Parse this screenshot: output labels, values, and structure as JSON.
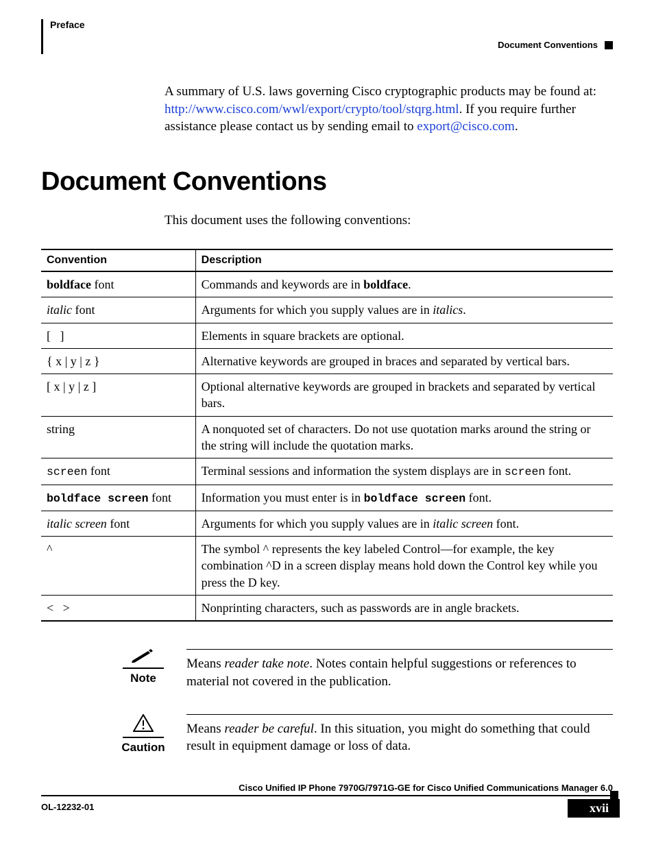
{
  "header": {
    "chapter": "Preface",
    "section": "Document Conventions"
  },
  "intro": {
    "pre": "A summary of U.S. laws governing Cisco cryptographic products may be found at: ",
    "link1": "http://www.cisco.com/wwl/export/crypto/tool/stqrg.html",
    "mid": ". If you require further assistance please contact us by sending email to ",
    "link2": "export@cisco.com",
    "post": "."
  },
  "heading": "Document Conventions",
  "lead": "This document uses the following conventions:",
  "table": {
    "col1_header": "Convention",
    "col2_header": "Description",
    "rows": {
      "r0": {
        "c_html": "<span class='bold'>boldface</span> font",
        "d_html": "Commands and keywords are in <span class='bold'>boldface</span>."
      },
      "r1": {
        "c_html": "<span class='ital'>italic</span> font",
        "d_html": "Arguments for which you supply values are in <span class='ital'>italics</span>."
      },
      "r2": {
        "c_html": "[&nbsp;&nbsp;&nbsp;]",
        "d_html": "Elements in square brackets are optional."
      },
      "r3": {
        "c_html": "{ x | y | z }",
        "d_html": "Alternative keywords are grouped in braces and separated by vertical bars."
      },
      "r4": {
        "c_html": "[ x | y | z ]",
        "d_html": "Optional alternative keywords are grouped in brackets and separated by vertical bars."
      },
      "r5": {
        "c_html": "string",
        "d_html": "A nonquoted set of characters. Do not use quotation marks around the string or the string will include the quotation marks."
      },
      "r6": {
        "c_html": "<span class='mono'>screen</span> font",
        "d_html": "Terminal sessions and information the system displays are in <span class='mono'>screen</span> font."
      },
      "r7": {
        "c_html": "<span class='mono bold'>boldface screen</span> font",
        "d_html": "Information you must enter is in <span class='mono bold'>boldface screen</span> font."
      },
      "r8": {
        "c_html": "<span class='ital'>italic screen</span> font",
        "d_html": "Arguments for which you supply values are in <span class='ital'>italic screen</span> font."
      },
      "r9": {
        "c_html": "^",
        "d_html": "The symbol ^ represents the key labeled Control—for example, the key combination ^D in a screen display means hold down the Control key while you press the D key."
      },
      "r10": {
        "c_html": "&lt;&nbsp;&nbsp;&nbsp;&gt;",
        "d_html": "Nonprinting characters, such as passwords are in angle brackets."
      }
    }
  },
  "note": {
    "label": "Note",
    "body_html": "Means <span class='ital'>reader take note</span>. Notes contain helpful suggestions or references to material not covered in the publication."
  },
  "caution": {
    "label": "Caution",
    "body_html": "Means <span class='ital'>reader be careful</span>. In this situation, you might do something that could result in equipment damage or loss of data."
  },
  "footer": {
    "book_title": "Cisco Unified IP Phone 7970G/7971G-GE for Cisco Unified Communications Manager 6.0",
    "doc_id": "OL-12232-01",
    "page_num": "xvii"
  }
}
